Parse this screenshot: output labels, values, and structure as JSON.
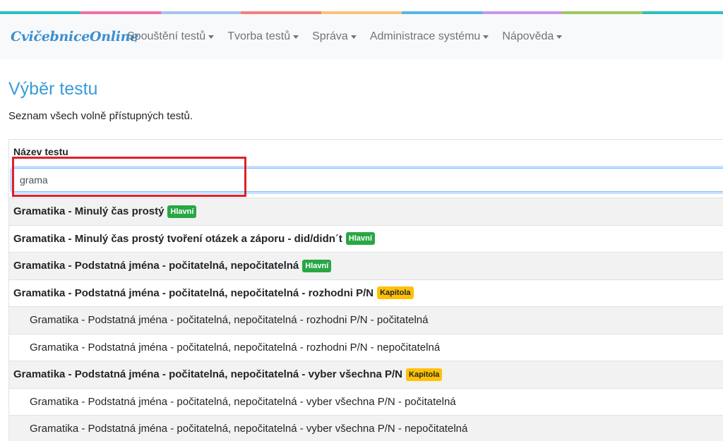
{
  "colors": {
    "stripes": [
      "#2bbfbf",
      "#f06eaa",
      "#a7c3ea",
      "#f47e7e",
      "#f8c47a",
      "#57b6e2",
      "#c996e6",
      "#9cc95a",
      "#2bbfbf"
    ],
    "brand": "#3a8fd3",
    "title": "#3a9ad9",
    "badge_main": "#28a745",
    "badge_chapter": "#ffc107"
  },
  "nav": {
    "brand": "CvičebniceOnline",
    "items": [
      {
        "label": "Spouštění testů"
      },
      {
        "label": "Tvorba testů"
      },
      {
        "label": "Správa"
      },
      {
        "label": "Administrace systému"
      },
      {
        "label": "Nápověda"
      }
    ]
  },
  "page": {
    "title": "Výběr testu",
    "subtitle": "Seznam všech volně přístupných testů."
  },
  "table": {
    "header": "Název testu",
    "search_value": "grama",
    "rows": [
      {
        "text": "Gramatika - Minulý čas prostý",
        "badge": "Hlavní",
        "level": "main"
      },
      {
        "text": "Gramatika - Minulý čas prostý tvoření otázek a záporu - did/didn´t",
        "badge": "Hlavní",
        "level": "main"
      },
      {
        "text": "Gramatika - Podstatná jména - počitatelná, nepočitatelná",
        "badge": "Hlavní",
        "level": "main"
      },
      {
        "text": "Gramatika - Podstatná jména - počitatelná, nepočitatelná - rozhodni P/N",
        "badge": "Kapitola",
        "level": "main"
      },
      {
        "text": "Gramatika - Podstatná jména - počitatelná, nepočitatelná - rozhodni P/N - počitatelná",
        "badge": "",
        "level": "child"
      },
      {
        "text": "Gramatika - Podstatná jména - počitatelná, nepočitatelná - rozhodni P/N - nepočitatelná",
        "badge": "",
        "level": "child"
      },
      {
        "text": "Gramatika - Podstatná jména - počitatelná, nepočitatelná - vyber všechna P/N",
        "badge": "Kapitola",
        "level": "main"
      },
      {
        "text": "Gramatika - Podstatná jména - počitatelná, nepočitatelná - vyber všechna P/N - počitatelná",
        "badge": "",
        "level": "child"
      },
      {
        "text": "Gramatika - Podstatná jména - počitatelná, nepočitatelná - vyber všechna P/N - nepočitatelná",
        "badge": "",
        "level": "child"
      }
    ]
  }
}
